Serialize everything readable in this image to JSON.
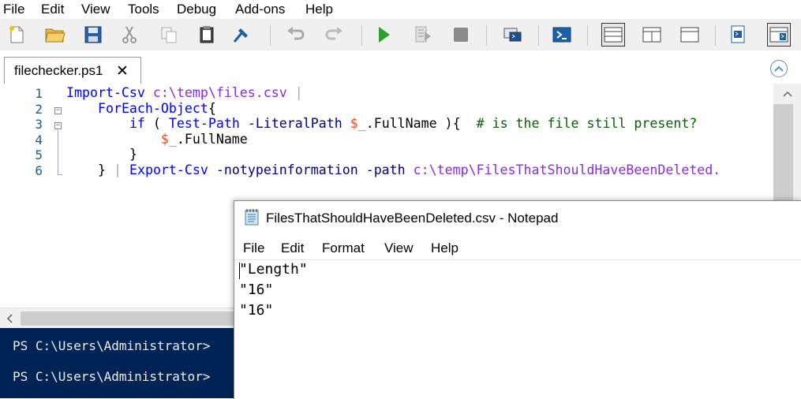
{
  "ise": {
    "menu": [
      "File",
      "Edit",
      "View",
      "Tools",
      "Debug",
      "Add-ons",
      "Help"
    ],
    "toolbar_icons": [
      "new-file-icon",
      "open-folder-icon",
      "save-icon",
      "cut-icon",
      "copy-icon",
      "paste-icon",
      "clear-console-icon",
      "undo-icon",
      "redo-icon",
      "run-script-icon",
      "run-selection-icon",
      "stop-icon",
      "remote-powershell-icon",
      "start-powershell-icon",
      "show-script-top-icon",
      "show-script-right-icon",
      "show-script-maximized-icon",
      "show-script-pane-icon",
      "show-commands-icon"
    ],
    "tab": {
      "label": "filechecker.ps1",
      "close": "✕"
    },
    "line_numbers": [
      "1",
      "2",
      "3",
      "4",
      "5",
      "6"
    ],
    "code": {
      "l1": {
        "cmd": "Import-Csv",
        "arg": "c:\\temp\\files.csv",
        "pipe": "|"
      },
      "l2": {
        "cmd": "ForEach-Object",
        "brace": "{"
      },
      "l3": {
        "kw": "if",
        "open": "(",
        "cmd": "Test-Path",
        "param": "-LiteralPath",
        "var": "$_",
        "member": ".FullName",
        "close": "){",
        "comment": "# is the file still present?"
      },
      "l4": {
        "var": "$_",
        "member": ".FullName"
      },
      "l5": {
        "brace": "}"
      },
      "l6": {
        "brace": "}",
        "pipe": "|",
        "cmd": "Export-Csv",
        "param1": "-notypeinformation",
        "param2": "-path",
        "arg": "c:\\temp\\FilesThatShouldHaveBeenDeleted."
      }
    },
    "console": {
      "prompt1": "PS C:\\Users\\Administrator>",
      "prompt2": "PS C:\\Users\\Administrator>"
    }
  },
  "notepad": {
    "title": "FilesThatShouldHaveBeenDeleted.csv - Notepad",
    "menu": [
      "File",
      "Edit",
      "Format",
      "View",
      "Help"
    ],
    "lines": [
      "\"Length\"",
      "\"16\"",
      "\"16\""
    ]
  },
  "colors": {
    "console_bg": "#012456",
    "cmdlet": "#0000ff",
    "string": "#8a2be2",
    "variable": "#ff4500",
    "comment": "#006400",
    "run_green": "#2e9e2e"
  }
}
